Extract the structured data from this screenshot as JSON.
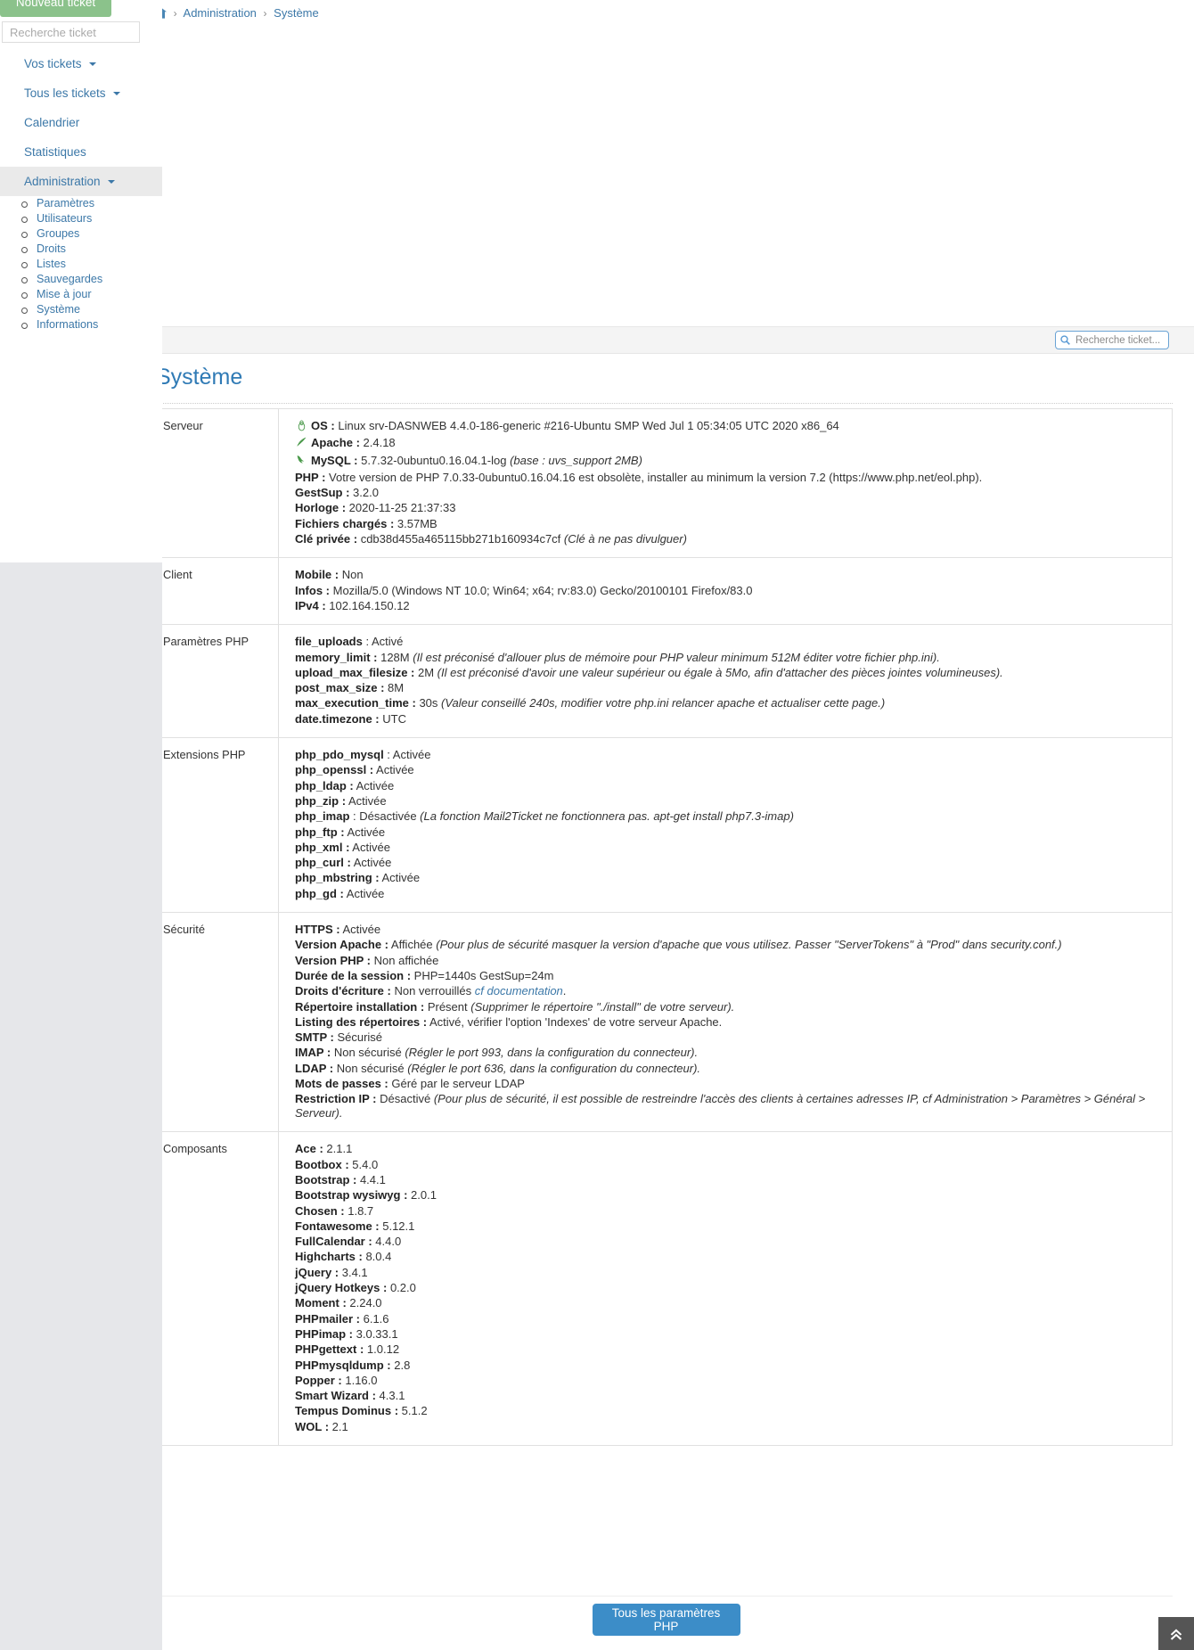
{
  "sidebar": {
    "new_ticket_label": "Nouveau ticket",
    "search_placeholder": "Recherche ticket",
    "nav": [
      {
        "label": "Vos tickets",
        "caret": true,
        "active": false
      },
      {
        "label": "Tous les tickets",
        "caret": true,
        "active": false
      },
      {
        "label": "Calendrier",
        "caret": false,
        "active": false
      },
      {
        "label": "Statistiques",
        "caret": false,
        "active": false
      },
      {
        "label": "Administration",
        "caret": true,
        "active": true
      }
    ],
    "subnav": [
      "Paramètres",
      "Utilisateurs",
      "Groupes",
      "Droits",
      "Listes",
      "Sauvegardes",
      "Mise à jour",
      "Système",
      "Informations"
    ]
  },
  "breadcrumb": {
    "home_icon": "home-icon",
    "items": [
      "Administration",
      "Système"
    ],
    "separator": "›"
  },
  "top_search": {
    "icon": "search-icon",
    "placeholder": "Recherche ticket...",
    "value": ""
  },
  "page": {
    "title": "Système"
  },
  "table": {
    "rows": [
      {
        "label": "Serveur",
        "lines": [
          {
            "icon": "linux-icon",
            "key": "OS :",
            "value": " Linux srv-DASNWEB 4.4.0-186-generic #216-Ubuntu SMP Wed Jul 1 05:34:05 UTC 2020 x86_64"
          },
          {
            "icon": "apache-feather-icon",
            "key": "Apache :",
            "value": " 2.4.18"
          },
          {
            "icon": "mysql-dolphin-icon",
            "key": "MySQL :",
            "value": " 5.7.32-0ubuntu0.16.04.1-log",
            "note": "(base : uvs_support 2MB)"
          },
          {
            "key": "PHP :",
            "value": " Votre version de PHP 7.0.33-0ubuntu0.16.04.16 est obsolète, installer au minimum la version 7.2 (https://www.php.net/eol.php)."
          },
          {
            "key": "GestSup :",
            "value": " 3.2.0"
          },
          {
            "key": " Horloge :",
            "value": " 2020-11-25 21:37:33"
          },
          {
            "key": " Fichiers chargés :",
            "value": " 3.57MB"
          },
          {
            "key": "Clé privée :",
            "value": " cdb38d455a465115bb271b160934c7cf",
            "note": "(Clé à ne pas divulguer)"
          }
        ]
      },
      {
        "label": "Client",
        "lines": [
          {
            "key": "Mobile :",
            "value": " Non"
          },
          {
            "key": "Infos :",
            "value": " Mozilla/5.0 (Windows NT 10.0; Win64; x64; rv:83.0) Gecko/20100101 Firefox/83.0"
          },
          {
            "key": "IPv4 :",
            "value": " 102.164.150.12"
          }
        ]
      },
      {
        "label": "Paramètres PHP",
        "lines": [
          {
            "key": "file_uploads",
            "value": " : Activé"
          },
          {
            "key": "memory_limit :",
            "value": " 128M",
            "note": "(Il est préconisé d'allouer plus de mémoire pour PHP valeur minimum 512M éditer votre fichier php.ini)."
          },
          {
            "key": "upload_max_filesize :",
            "value": " 2M",
            "note": "(Il est préconisé d'avoir une valeur supérieur ou égale à 5Mo, afin d'attacher des pièces jointes volumineuses)."
          },
          {
            "key": "post_max_size :",
            "value": " 8M"
          },
          {
            "key": "max_execution_time :",
            "value": " 30s",
            "note": "(Valeur conseillé 240s, modifier votre php.ini relancer apache et actualiser cette page.)"
          },
          {
            "key": "date.timezone :",
            "value": " UTC"
          }
        ]
      },
      {
        "label": "Extensions PHP",
        "lines": [
          {
            "key": "php_pdo_mysql",
            "value": " : Activée"
          },
          {
            "key": "php_openssl :",
            "value": " Activée"
          },
          {
            "key": "php_ldap :",
            "value": " Activée"
          },
          {
            "key": "php_zip :",
            "value": " Activée"
          },
          {
            "key": "php_imap",
            "value": " : Désactivée",
            "note": "(La fonction Mail2Ticket ne fonctionnera pas. apt-get install php7.3-imap)"
          },
          {
            "key": "php_ftp :",
            "value": " Activée"
          },
          {
            "key": "php_xml :",
            "value": " Activée"
          },
          {
            "key": "php_curl :",
            "value": " Activée"
          },
          {
            "key": "php_mbstring :",
            "value": " Activée"
          },
          {
            "key": "php_gd :",
            "value": " Activée"
          }
        ]
      },
      {
        "label": "Sécurité",
        "lines": [
          {
            "key": "HTTPS :",
            "value": " Activée"
          },
          {
            "key": "Version Apache :",
            "value": " Affichée",
            "note": "(Pour plus de sécurité masquer la version d'apache que vous utilisez. Passer \"ServerTokens\" à \"Prod\" dans security.conf.)"
          },
          {
            "key": "Version PHP :",
            "value": " Non affichée"
          },
          {
            "key": "Durée de la session :",
            "value": " PHP=1440s GestSup=24m"
          },
          {
            "key": "Droits d'écriture :",
            "value": " Non verrouillés ",
            "link": "cf documentation",
            "suffix": "."
          },
          {
            "key": "Répertoire installation :",
            "value": " Présent",
            "note": "(Supprimer le répertoire \"./install\" de votre serveur)."
          },
          {
            "key": "Listing des répertoires :",
            "value": " Activé, vérifier l'option 'Indexes' de votre serveur Apache."
          },
          {
            "key": "SMTP :",
            "value": " Sécurisé"
          },
          {
            "key": "IMAP :",
            "value": " Non sécurisé",
            "note": "(Régler le port 993, dans la configuration du connecteur)."
          },
          {
            "key": "LDAP :",
            "value": " Non sécurisé",
            "note": "(Régler le port 636, dans la configuration du connecteur)."
          },
          {
            "key": "Mots de passes :",
            "value": " Géré par le serveur LDAP"
          },
          {
            "key": "Restriction IP :",
            "value": " Désactivé",
            "note": "(Pour plus de sécurité, il est possible de restreindre l'accès des clients à certaines adresses IP, cf Administration > Paramètres > Général > Serveur)."
          }
        ]
      },
      {
        "label": "Composants",
        "lines": [
          {
            "key": "Ace :",
            "value": " 2.1.1"
          },
          {
            "key": "Bootbox :",
            "value": " 5.4.0"
          },
          {
            "key": "Bootstrap :",
            "value": " 4.4.1"
          },
          {
            "key": "Bootstrap wysiwyg :",
            "value": " 2.0.1"
          },
          {
            "key": "Chosen :",
            "value": " 1.8.7"
          },
          {
            "key": "Fontawesome :",
            "value": " 5.12.1"
          },
          {
            "key": "FullCalendar :",
            "value": " 4.4.0"
          },
          {
            "key": "Highcharts :",
            "value": " 8.0.4"
          },
          {
            "key": "jQuery :",
            "value": " 3.4.1"
          },
          {
            "key": "jQuery Hotkeys :",
            "value": " 0.2.0"
          },
          {
            "key": "Moment :",
            "value": " 2.24.0"
          },
          {
            "key": "PHPmailer :",
            "value": " 6.1.6"
          },
          {
            "key": "PHPimap :",
            "value": " 3.0.33.1"
          },
          {
            "key": "PHPgettext :",
            "value": " 1.0.12"
          },
          {
            "key": "PHPmysqldump :",
            "value": " 2.8"
          },
          {
            "key": "Popper :",
            "value": " 1.16.0"
          },
          {
            "key": "Smart Wizard :",
            "value": " 4.3.1"
          },
          {
            "key": "Tempus Dominus :",
            "value": " 5.1.2"
          },
          {
            "key": "WOL :",
            "value": " 2.1"
          }
        ]
      }
    ]
  },
  "footer": {
    "php_params_button": "Tous les paramètres PHP",
    "scroll_top_icon": "chevron-double-up-icon"
  },
  "colors": {
    "accent_blue": "#3c8dc8",
    "link_blue": "#3c78a8",
    "green_button": "#8bc28b",
    "icon_green": "#4c9a4c",
    "panel_gray": "#e6e7ea"
  }
}
